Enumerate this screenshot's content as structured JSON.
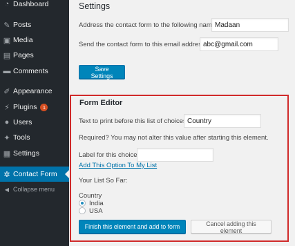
{
  "sidebar": {
    "items": [
      {
        "label": "Dashboard",
        "icon": "dashboard-icon",
        "glyph": "◔"
      },
      {
        "label": "Posts",
        "icon": "pushpin-icon",
        "glyph": "✎"
      },
      {
        "label": "Media",
        "icon": "media-icon",
        "glyph": "▣"
      },
      {
        "label": "Pages",
        "icon": "pages-icon",
        "glyph": "▤"
      },
      {
        "label": "Comments",
        "icon": "comments-icon",
        "glyph": "▬"
      },
      {
        "label": "Appearance",
        "icon": "appearance-icon",
        "glyph": "✐"
      },
      {
        "label": "Plugins",
        "icon": "plugins-icon",
        "glyph": "⚡",
        "badge": "1"
      },
      {
        "label": "Users",
        "icon": "users-icon",
        "glyph": "●"
      },
      {
        "label": "Tools",
        "icon": "tools-icon",
        "glyph": "✦"
      },
      {
        "label": "Settings",
        "icon": "settings-icon",
        "glyph": "▦"
      },
      {
        "label": "Contact Form",
        "icon": "gear-icon",
        "glyph": "✲",
        "current": true
      }
    ],
    "collapse_label": "Collapse menu",
    "collapse_glyph": "◀"
  },
  "settings": {
    "title": "Settings",
    "address_label": "Address the contact form to the following name:",
    "address_value": "Madaan",
    "email_label": "Send the contact form to this email address:",
    "email_value": "abc@gmail.com",
    "save_label": "Save Settings"
  },
  "form_editor": {
    "title": "Form Editor",
    "print_label": "Text to print before this list of choices:",
    "print_value": "Country",
    "required_text": "Required? You may not alter this value after starting this element.",
    "choice_label": "Label for this choice:",
    "choice_value": "",
    "add_option_link": "Add This Option To My List",
    "list_label": "Your List So Far:",
    "list_heading": "Country",
    "options": [
      {
        "label": "India",
        "checked": true
      },
      {
        "label": "USA",
        "checked": false
      }
    ],
    "finish_label": "Finish this element and add to form",
    "cancel_label": "Cancel adding this element"
  },
  "colors": {
    "sidebar_bg": "#23282d",
    "current_bg": "#0073aa",
    "primary_button": "#0085ba",
    "highlight_border": "#d02a2a",
    "badge": "#d54e21"
  }
}
